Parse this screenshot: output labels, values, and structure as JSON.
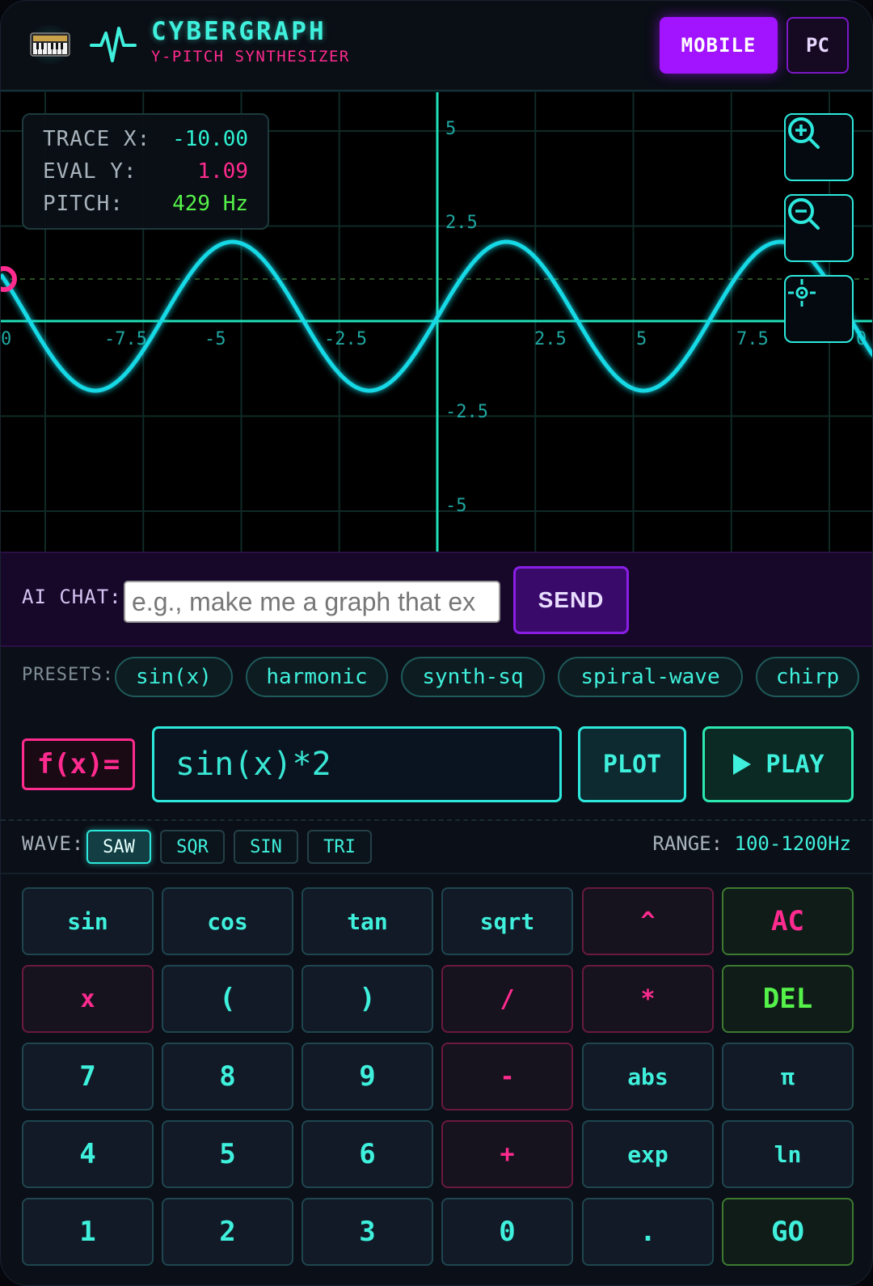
{
  "header": {
    "title": "CYBERGRAPH",
    "subtitle": "Y-PITCH SYNTHESIZER",
    "mode_mobile": "MOBILE",
    "mode_pc": "PC"
  },
  "trace": {
    "x_label": "TRACE X:",
    "x_value": "-10.00",
    "y_label": "EVAL Y:",
    "y_value": "1.09",
    "pitch_label": "PITCH:",
    "pitch_value": "429 Hz"
  },
  "graph": {
    "x_ticks": [
      "0",
      "-7.5",
      "-5",
      "-2.5",
      "2.5",
      "5",
      "7.5",
      "0"
    ],
    "y_ticks": [
      "5",
      "2.5",
      "-2.5",
      "-5"
    ],
    "zoom_in_icon": "zoom-in-icon",
    "zoom_out_icon": "zoom-out-icon",
    "center_icon": "crosshair-icon",
    "curve_color": "#19d9e6",
    "axis_color": "#1fdfb8"
  },
  "ai_chat": {
    "label": "AI CHAT:",
    "placeholder": "e.g., make me a graph that ex",
    "send_label": "SEND"
  },
  "presets": {
    "label": "PRESETS:",
    "items": [
      "sin(x)",
      "harmonic",
      "synth-sq",
      "spiral-wave",
      "chirp"
    ]
  },
  "function": {
    "label": "f(x)=",
    "value": "sin(x)*2",
    "plot_label": "PLOT",
    "play_label": "PLAY"
  },
  "wave": {
    "label": "WAVE:",
    "options": [
      "SAW",
      "SQR",
      "SIN",
      "TRI"
    ],
    "selected": "SAW",
    "range_label": "RANGE:",
    "range_value": "100-1200Hz"
  },
  "keypad": {
    "rows": [
      [
        "sin",
        "cos",
        "tan",
        "sqrt",
        "^",
        "AC"
      ],
      [
        "x",
        "(",
        ")",
        "/",
        "*",
        "DEL"
      ],
      [
        "7",
        "8",
        "9",
        "-",
        "abs",
        "π"
      ],
      [
        "4",
        "5",
        "6",
        "+",
        "exp",
        "ln"
      ],
      [
        "1",
        "2",
        "3",
        "0",
        ".",
        "GO"
      ]
    ]
  },
  "colors": {
    "accent_cyan": "#3ff0dc",
    "accent_pink": "#ff2b8f",
    "accent_green": "#55f24a",
    "accent_purple": "#a213ff"
  }
}
